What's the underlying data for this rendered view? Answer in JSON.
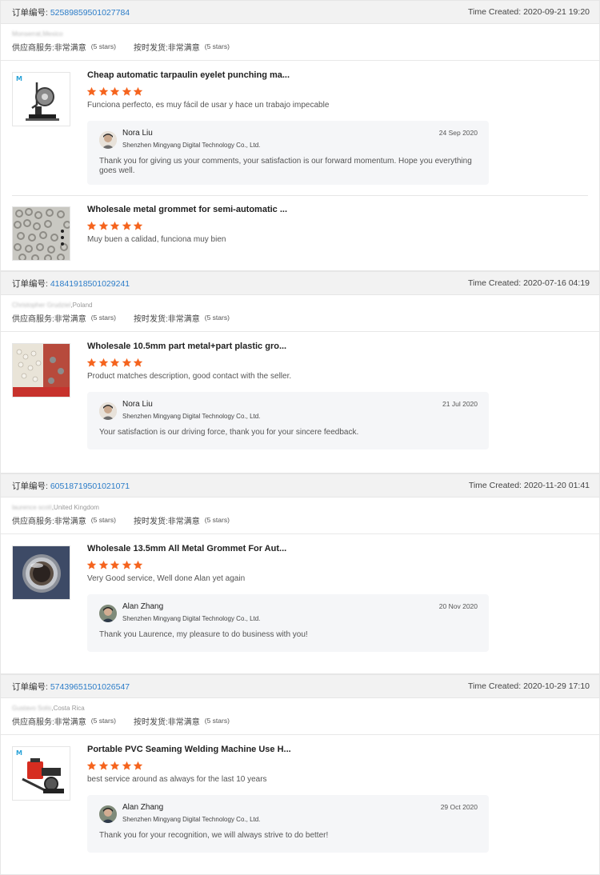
{
  "labels": {
    "order_no": "订单编号: ",
    "time_created": "Time Created: ",
    "supplier_service": "供应商服务: ",
    "on_time_delivery": "按时发货: ",
    "very_satisfied": "非常满意",
    "five_stars": "(5 stars)"
  },
  "colors": {
    "star": "#f5641e",
    "order_number": "#2b7cc8",
    "header_bg": "#f2f2f2",
    "reply_bg": "#f5f6f8"
  },
  "orders": [
    {
      "order_number": "52589859501027784",
      "time_created": "2020-09-21 19:20",
      "buyer_hidden": "Monserrat,Mexico",
      "buyer_country": "",
      "products": [
        {
          "title": "Cheap automatic tarpaulin eyelet punching ma...",
          "image": "eyelet-punching-machine-image",
          "rating": 5,
          "comment": "Funciona perfecto, es muy fácil de usar y hace un trabajo impecable",
          "reply": {
            "name": "Nora Liu",
            "company": "Shenzhen Mingyang Digital Technology Co., Ltd.",
            "date": "24 Sep 2020",
            "text": "Thank you for giving us your comments, your satisfaction is our forward momentum. Hope you everything goes well."
          }
        },
        {
          "title": "Wholesale metal grommet for semi-automatic ...",
          "image": "metal-grommets-image",
          "rating": 5,
          "comment": "Muy buen a calidad, funciona muy bien"
        }
      ]
    },
    {
      "order_number": "41841918501029241",
      "time_created": "2020-07-16 04:19",
      "buyer_hidden": "Christopher Grudziel",
      "buyer_country": ",Poland",
      "products": [
        {
          "title": "Wholesale 10.5mm part metal+part plastic gro...",
          "image": "plastic-grommets-image",
          "rating": 5,
          "comment": "Product matches description, good contact with the seller.",
          "reply": {
            "name": "Nora Liu",
            "company": "Shenzhen Mingyang Digital Technology Co., Ltd.",
            "date": "21 Jul 2020",
            "text": "Your satisfaction is our driving force, thank you for your sincere feedback."
          }
        }
      ]
    },
    {
      "order_number": "60518719501021071",
      "time_created": "2020-11-20 01:41",
      "buyer_hidden": "laurence scott",
      "buyer_country": ",United Kingdom",
      "products": [
        {
          "title": "Wholesale 13.5mm All Metal Grommet For Aut...",
          "image": "metal-grommet-closeup-image",
          "rating": 5,
          "comment": "Very Good service, Well done Alan yet again",
          "reply": {
            "name": "Alan Zhang",
            "company": "Shenzhen Mingyang Digital Technology Co., Ltd.",
            "date": "20 Nov 2020",
            "text": "Thank you Laurence, my pleasure to do business with you!"
          }
        }
      ]
    },
    {
      "order_number": "57439651501026547",
      "time_created": "2020-10-29 17:10",
      "buyer_hidden": "Gustavo Solis",
      "buyer_country": ",Costa Rica",
      "products": [
        {
          "title": "Portable PVC Seaming Welding Machine Use H...",
          "image": "pvc-welding-machine-image",
          "rating": 5,
          "comment": "best service around as always for the last 10 years",
          "reply": {
            "name": "Alan Zhang",
            "company": "Shenzhen Mingyang Digital Technology Co., Ltd.",
            "date": "29 Oct 2020",
            "text": "Thank you for your recognition, we will always strive to do better!"
          }
        }
      ]
    }
  ]
}
